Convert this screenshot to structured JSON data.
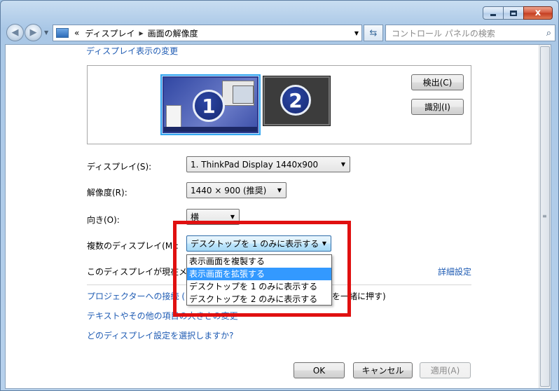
{
  "window": {
    "minimize_label": "",
    "maximize_label": "",
    "close_label": "x"
  },
  "nav": {
    "back_glyph": "◀",
    "forward_glyph": "▶",
    "breadcrumb": [
      "«",
      "ディスプレイ",
      "画面の解像度"
    ],
    "breadcrumb_sep": "▶",
    "search_placeholder": "コントロール パネルの検索",
    "refresh_glyph": "⇆",
    "search_glyph": "⌕"
  },
  "content": {
    "heading": "ディスプレイ表示の変更",
    "monitor1_number": "1",
    "monitor2_number": "2",
    "detect_button": "検出(C)",
    "identify_button": "識別(I)",
    "display_label": "ディスプレイ(S):",
    "display_value": "1. ThinkPad Display 1440x900",
    "resolution_label": "解像度(R):",
    "resolution_value": "1440 × 900 (推奨)",
    "orientation_label": "向き(O):",
    "orientation_value": "横",
    "multi_label": "複数のディスプレイ(M):",
    "multi_value": "デスクトップを 1 のみに表示する",
    "multi_options": [
      "表示画面を複製する",
      "表示画面を拡張する",
      "デスクトップを 1 のみに表示する",
      "デスクトップを 2 のみに表示する"
    ],
    "main_display_text": "このディスプレイが現在メ",
    "advanced_link": "詳細設定",
    "projector_link": "プロジェクターへの接続 (",
    "projector_suffix": "を一緒に押す)",
    "text_size_link": "テキストやその他の項目の大きさの変更",
    "which_setting_link": "どのディスプレイ設定を選択しますか?",
    "ok_button": "OK",
    "cancel_button": "キャンセル",
    "apply_button": "適用(A)"
  },
  "colors": {
    "link": "#1e5bb3",
    "highlight": "#3399ff",
    "annotation": "#e01010"
  }
}
